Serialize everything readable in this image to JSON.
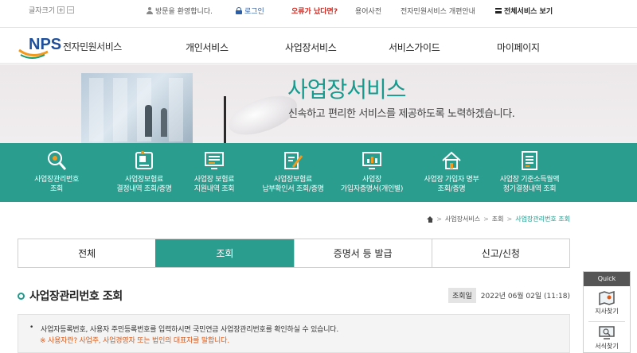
{
  "top": {
    "font_size_label": "글자크기",
    "font_plus": "+",
    "font_minus": "−",
    "welcome": "방문을 환영합니다.",
    "login": "로그인",
    "error_report": "오류가 났다면?",
    "dictionary": "용어사전",
    "renewal_notice": "전자민원서비스 개편안내",
    "all_services": "전체서비스 보기"
  },
  "logo": {
    "mark": "NPS",
    "name": "전자민원서비스"
  },
  "nav": [
    {
      "label": "개인서비스"
    },
    {
      "label": "사업장서비스"
    },
    {
      "label": "서비스가이드"
    },
    {
      "label": "마이페이지"
    }
  ],
  "hero": {
    "title": "사업장서비스",
    "subtitle": "신속하고 편리한 서비스를 제공하도록 노력하겠습니다."
  },
  "quick_menu": [
    {
      "line1": "사업장관리번호",
      "line2": "조회",
      "icon": "search-icon"
    },
    {
      "line1": "사업장보험료",
      "line2": "결정내역 조회/증명",
      "icon": "document-id-icon"
    },
    {
      "line1": "사업장 보험료",
      "line2": "지원내역 조회",
      "icon": "monitor-list-icon"
    },
    {
      "line1": "사업장보험료",
      "line2": "납부확인서 조회/증명",
      "icon": "pen-document-icon"
    },
    {
      "line1": "사업장",
      "line2": "가입자증명서(개인별)",
      "icon": "monitor-chart-icon"
    },
    {
      "line1": "사업장 가입자 명부",
      "line2": "조회/증명",
      "icon": "home-icon"
    },
    {
      "line1": "사업장 기준소득월액",
      "line2": "정기결정내역 조회",
      "icon": "document-list-icon"
    }
  ],
  "breadcrumb": {
    "level1": "사업장서비스",
    "level2": "조회",
    "current": "사업장관리번호 조회"
  },
  "tabs": [
    {
      "label": "전체",
      "active": false
    },
    {
      "label": "조회",
      "active": true
    },
    {
      "label": "증명서 등 발급",
      "active": false
    },
    {
      "label": "신고/신청",
      "active": false
    }
  ],
  "page": {
    "title": "사업장관리번호 조회",
    "date_label": "조회일",
    "date_value": "2022년 06월 02일 (11:18)"
  },
  "notice": {
    "line1": "사업자등록번호, 사용자 주민등록번호를 입력하시면 국민연금 사업장관리번호를 확인하실 수 있습니다.",
    "line2": "※ 사용자란? 사업주, 사업경영자 또는 법인의 대표자를 말합니다."
  },
  "quick_panel": {
    "title": "Quick",
    "items": [
      {
        "label": "지사찾기"
      },
      {
        "label": "서식찾기"
      }
    ]
  },
  "colors": {
    "accent": "#2a9d8f",
    "title": "#169a8d",
    "warning": "#e05a16",
    "brand": "#1d4f9c"
  }
}
